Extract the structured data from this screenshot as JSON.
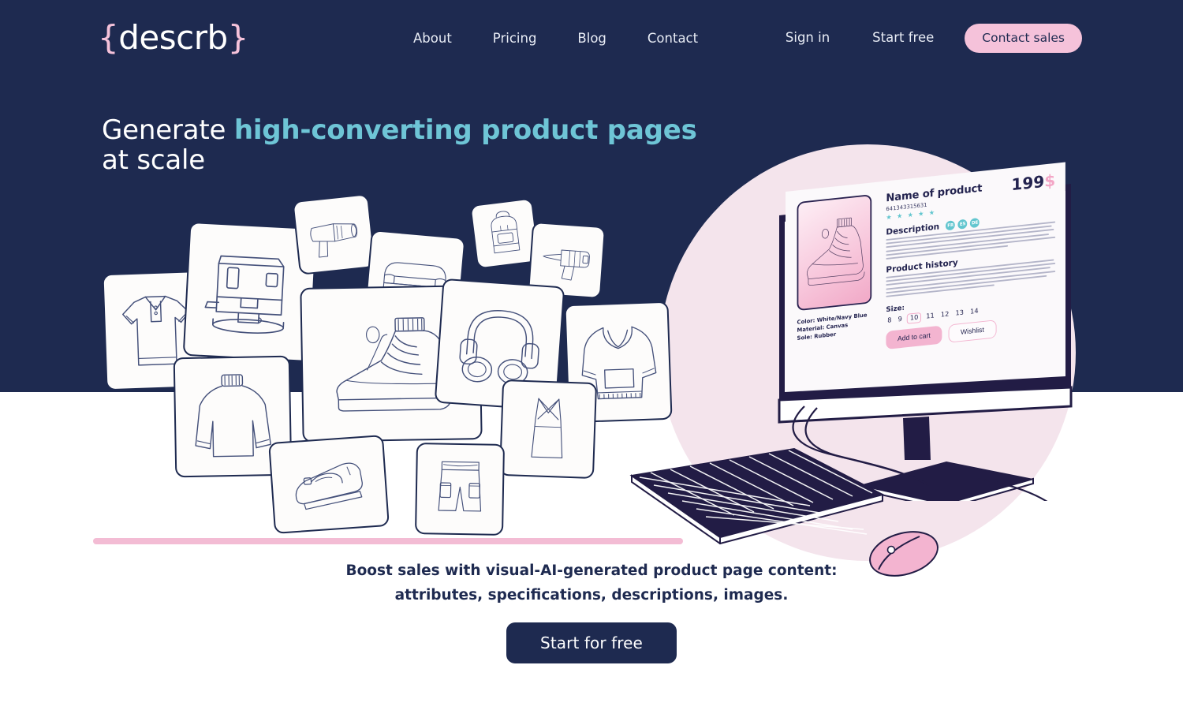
{
  "brand": {
    "prefix": "{",
    "name": "descrb",
    "suffix": "}"
  },
  "nav": {
    "items": [
      {
        "label": "About"
      },
      {
        "label": "Pricing"
      },
      {
        "label": "Blog"
      },
      {
        "label": "Contact"
      }
    ],
    "sign_in": "Sign in",
    "start_free": "Start free",
    "contact_sales": "Contact sales"
  },
  "hero": {
    "line1_plain": "Generate ",
    "line1_accent": "high-converting product pages",
    "line2_plain": "at scale"
  },
  "subcopy": {
    "line1": "Boost sales with visual-AI-generated product page content:",
    "line2": "attributes, specifications, descriptions, images."
  },
  "cta": {
    "start_for_free": "Start for free"
  },
  "product_page": {
    "name": "Name of product",
    "sku": "641343315631",
    "price": "199",
    "currency": "$",
    "rating_stars": "★ ★ ★ ★ ★",
    "description_title": "Description",
    "languages": [
      "FR",
      "ES",
      "DE"
    ],
    "history_title": "Product history",
    "attributes": [
      "Color: White/Navy Blue",
      "Material: Canvas",
      "Sole: Rubber"
    ],
    "size_label": "Size:",
    "sizes": [
      "8",
      "9",
      "10",
      "11",
      "12",
      "13",
      "14"
    ],
    "selected_size": "10",
    "add_to_cart": "Add to cart",
    "wishlist": "Wishlist"
  },
  "collage": {
    "items": [
      {
        "name": "polo-shirt"
      },
      {
        "name": "coffee-machine"
      },
      {
        "name": "hair-dryer"
      },
      {
        "name": "sofa"
      },
      {
        "name": "backpack"
      },
      {
        "name": "drill"
      },
      {
        "name": "sweater"
      },
      {
        "name": "sneaker"
      },
      {
        "name": "headphones"
      },
      {
        "name": "hoodie"
      },
      {
        "name": "iron"
      },
      {
        "name": "cargo-shorts"
      },
      {
        "name": "dress"
      }
    ]
  },
  "colors": {
    "navy": "#1e2a50",
    "teal_accent": "#6ec5d6",
    "pink_accent": "#f5c2da",
    "pink_circle": "#f4e4ec",
    "white": "#ffffff"
  }
}
